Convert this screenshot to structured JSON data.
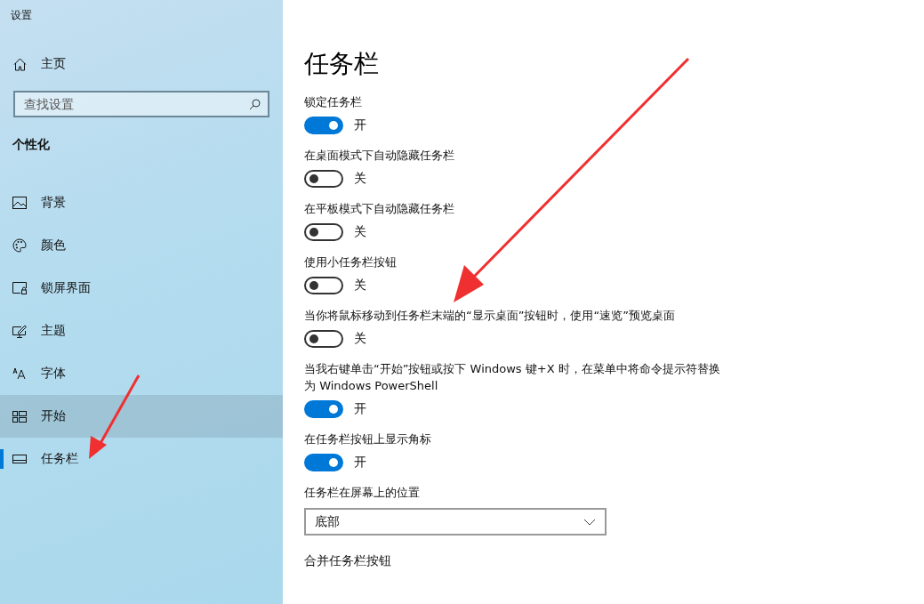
{
  "window": {
    "title": "设置"
  },
  "sidebar": {
    "home": {
      "label": "主页"
    },
    "search": {
      "placeholder": "查找设置"
    },
    "section": "个性化",
    "items": [
      {
        "label": "背景",
        "selected": false,
        "hovered": false
      },
      {
        "label": "颜色",
        "selected": false,
        "hovered": false
      },
      {
        "label": "锁屏界面",
        "selected": false,
        "hovered": false
      },
      {
        "label": "主题",
        "selected": false,
        "hovered": false
      },
      {
        "label": "字体",
        "selected": false,
        "hovered": false
      },
      {
        "label": "开始",
        "selected": false,
        "hovered": true
      },
      {
        "label": "任务栏",
        "selected": true,
        "hovered": false
      }
    ]
  },
  "page": {
    "title": "任务栏",
    "settings": [
      {
        "kind": "toggle",
        "label": "锁定任务栏",
        "on": true,
        "state_text": "开"
      },
      {
        "kind": "toggle",
        "label": "在桌面模式下自动隐藏任务栏",
        "on": false,
        "state_text": "关"
      },
      {
        "kind": "toggle",
        "label": "在平板模式下自动隐藏任务栏",
        "on": false,
        "state_text": "关"
      },
      {
        "kind": "toggle",
        "label": "使用小任务栏按钮",
        "on": false,
        "state_text": "关"
      },
      {
        "kind": "toggle",
        "label": "当你将鼠标移动到任务栏末端的“显示桌面”按钮时，使用“速览”预览桌面",
        "on": false,
        "state_text": "关"
      },
      {
        "kind": "toggle",
        "label": "当我右键单击“开始”按钮或按下 Windows 键+X 时，在菜单中将命令提示符替换为 Windows PowerShell",
        "on": true,
        "state_text": "开"
      },
      {
        "kind": "toggle",
        "label": "在任务栏按钮上显示角标",
        "on": true,
        "state_text": "开"
      },
      {
        "kind": "dropdown",
        "label": "任务栏在屏幕上的位置",
        "value": "底部"
      },
      {
        "kind": "heading",
        "label": "合并任务栏按钮"
      }
    ]
  }
}
